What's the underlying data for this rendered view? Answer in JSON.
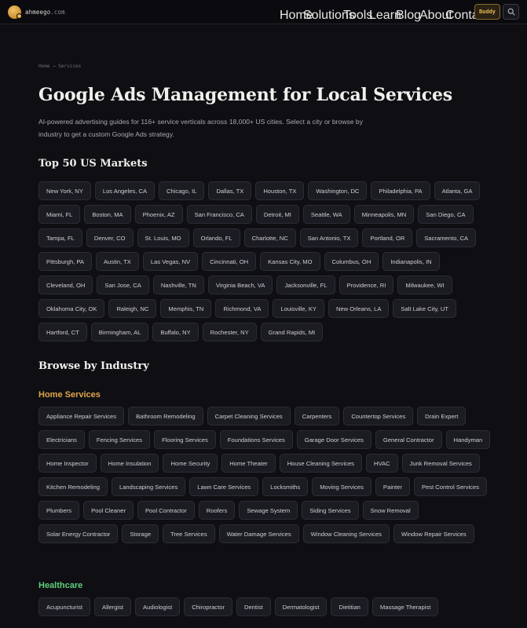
{
  "header": {
    "logo_text_main": "ahmeego",
    "logo_text_tld": ".com",
    "nav": [
      "Home",
      "Solutions",
      "Tools",
      "Learn",
      "Blog",
      "About",
      "Contact"
    ],
    "buddy_label": "Buddy",
    "search_icon": "search-icon",
    "accent_color": "#e7b659"
  },
  "breadcrumb": "Home → Services",
  "page_title": "Google Ads Management for Local Services",
  "subtitle": "AI-powered advertising guides for 116+ service verticals across 18,000+ US cities. Select a city or browse by industry to get a custom Google Ads strategy.",
  "markets": {
    "heading": "Top 50 US Markets",
    "cities": [
      "New York, NY",
      "Los Angeles, CA",
      "Chicago, IL",
      "Dallas, TX",
      "Houston, TX",
      "Washington, DC",
      "Philadelphia, PA",
      "Atlanta, GA",
      "Miami, FL",
      "Boston, MA",
      "Phoenix, AZ",
      "San Francisco, CA",
      "Detroit, MI",
      "Seattle, WA",
      "Minneapolis, MN",
      "San Diego, CA",
      "Tampa, FL",
      "Denver, CO",
      "St. Louis, MO",
      "Orlando, FL",
      "Charlotte, NC",
      "San Antonio, TX",
      "Portland, OR",
      "Sacramento, CA",
      "Pittsburgh, PA",
      "Austin, TX",
      "Las Vegas, NV",
      "Cincinnati, OH",
      "Kansas City, MO",
      "Columbus, OH",
      "Indianapolis, IN",
      "Cleveland, OH",
      "San Jose, CA",
      "Nashville, TN",
      "Virginia Beach, VA",
      "Jacksonville, FL",
      "Providence, RI",
      "Milwaukee, WI",
      "Oklahoma City, OK",
      "Raleigh, NC",
      "Memphis, TN",
      "Richmond, VA",
      "Louisville, KY",
      "New Orleans, LA",
      "Salt Lake City, UT",
      "Hartford, CT",
      "Birmingham, AL",
      "Buffalo, NY",
      "Rochester, NY",
      "Grand Rapids, MI"
    ]
  },
  "industry": {
    "heading": "Browse by Industry",
    "home_services": {
      "heading": "Home Services",
      "color": "#e0a54a",
      "items": [
        "Appliance Repair Services",
        "Bathroom Remodeling",
        "Carpet Cleaning Services",
        "Carpenters",
        "Countertop Services",
        "Drain Expert",
        "Electricians",
        "Fencing Services",
        "Flooring Services",
        "Foundations Services",
        "Garage Door Services",
        "General Contractor",
        "Handyman",
        "Home Inspector",
        "Home Insulation",
        "Home Security",
        "Home Theater",
        "House Cleaning Services",
        "HVAC",
        "Junk Removal Services",
        "Kitchen Remodeling",
        "Landscaping Services",
        "Lawn Care Services",
        "Locksmiths",
        "Moving Services",
        "Painter",
        "Pest Control Services",
        "Plumbers",
        "Pool Cleaner",
        "Pool Contractor",
        "Roofers",
        "Sewage System",
        "Siding Services",
        "Snow Removal",
        "Solar Energy Contractor",
        "Storage",
        "Tree Services",
        "Water Damage Services",
        "Window Cleaning Services",
        "Window Repair Services"
      ]
    },
    "healthcare": {
      "heading": "Healthcare",
      "color": "#5fcf7a",
      "items": [
        "Acupuncturist",
        "Allergist",
        "Audiologist",
        "Chiropractor",
        "Dentist",
        "Dermatologist",
        "Dietitian",
        "Massage Therapist"
      ]
    }
  }
}
